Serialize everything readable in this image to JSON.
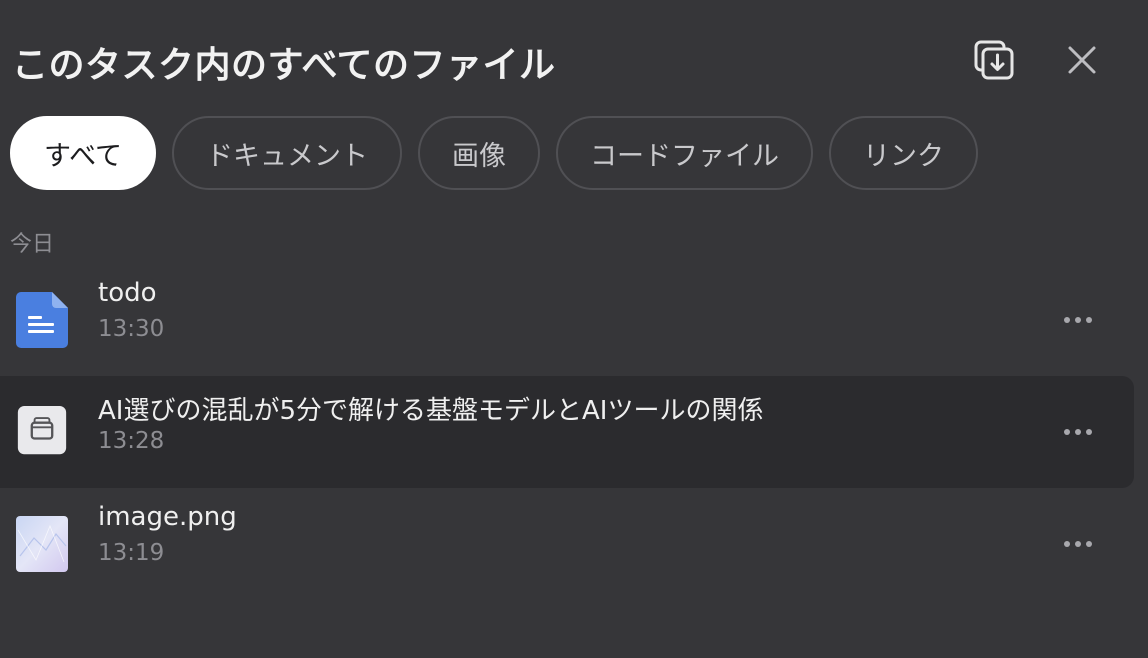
{
  "header": {
    "title": "このタスク内のすべてのファイル"
  },
  "filters": [
    {
      "label": "すべて",
      "active": true
    },
    {
      "label": "ドキュメント",
      "active": false
    },
    {
      "label": "画像",
      "active": false
    },
    {
      "label": "コードファイル",
      "active": false
    },
    {
      "label": "リンク",
      "active": false
    }
  ],
  "section": {
    "label": "今日"
  },
  "files": [
    {
      "name": "todo",
      "time": "13:30",
      "icon": "document-icon"
    },
    {
      "name": "AI選びの混乱が5分で解ける基盤モデルとAIツールの関係",
      "time": "13:28",
      "icon": "webpage-icon"
    },
    {
      "name": "image.png",
      "time": "13:19",
      "icon": "image-thumbnail-icon"
    }
  ],
  "colors": {
    "background": "#363639",
    "highlight_row": "#2b2b2e",
    "doc_icon_blue": "#4a7fe0",
    "active_chip": "#ffffff"
  }
}
